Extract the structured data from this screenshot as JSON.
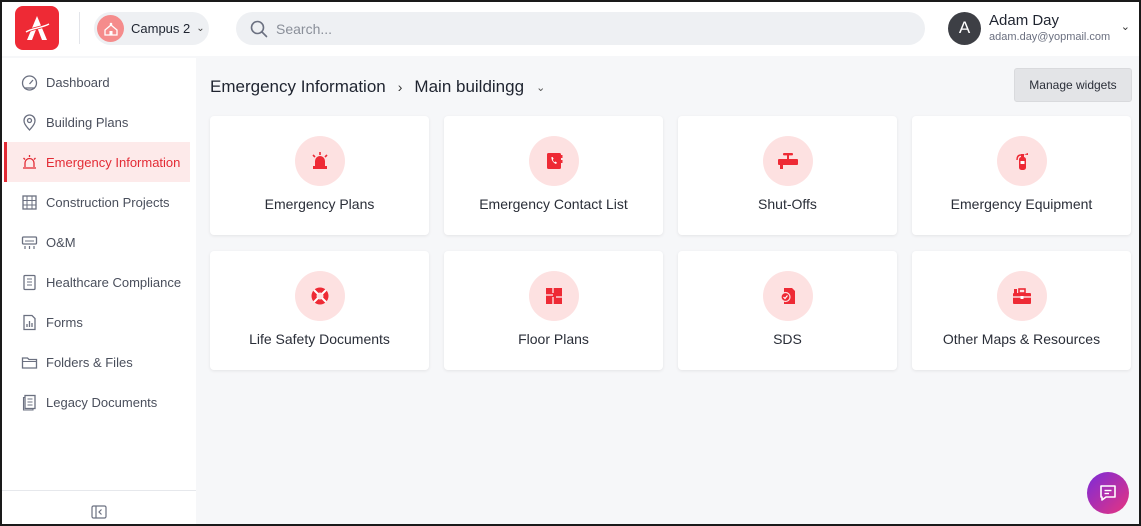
{
  "app": {
    "logo_letter": "A",
    "brand_color": "#ee2a35",
    "accent_light": "#fde1e1"
  },
  "campus": {
    "label": "Campus 2"
  },
  "search": {
    "placeholder": "Search..."
  },
  "user": {
    "initial": "A",
    "name": "Adam Day",
    "email": "adam.day@yopmail.com"
  },
  "sidebar": {
    "items": [
      {
        "label": "Dashboard",
        "icon": "gauge-icon",
        "active": false
      },
      {
        "label": "Building Plans",
        "icon": "location-pin-icon",
        "active": false
      },
      {
        "label": "Emergency Information",
        "icon": "siren-icon",
        "active": true
      },
      {
        "label": "Construction Projects",
        "icon": "scaffold-icon",
        "active": false
      },
      {
        "label": "O&M",
        "icon": "hvac-unit-icon",
        "active": false
      },
      {
        "label": "Healthcare Compliance",
        "icon": "notebook-icon",
        "active": false
      },
      {
        "label": "Forms",
        "icon": "form-chart-icon",
        "active": false
      },
      {
        "label": "Folders & Files",
        "icon": "folder-icon",
        "active": false
      },
      {
        "label": "Legacy Documents",
        "icon": "documents-icon",
        "active": false
      }
    ]
  },
  "breadcrumb": {
    "root": "Emergency Information",
    "current": "Main buildingg"
  },
  "toolbar": {
    "manage_label": "Manage widgets"
  },
  "widgets": [
    {
      "label": "Emergency Plans",
      "icon": "siren-icon"
    },
    {
      "label": "Emergency Contact List",
      "icon": "phone-book-icon"
    },
    {
      "label": "Shut-Offs",
      "icon": "valve-icon"
    },
    {
      "label": "Emergency Equipment",
      "icon": "fire-extinguisher-icon"
    },
    {
      "label": "Life Safety Documents",
      "icon": "lifebuoy-icon"
    },
    {
      "label": "Floor Plans",
      "icon": "floor-plan-icon"
    },
    {
      "label": "SDS",
      "icon": "safety-sheet-icon"
    },
    {
      "label": "Other Maps & Resources",
      "icon": "toolbox-icon"
    }
  ]
}
